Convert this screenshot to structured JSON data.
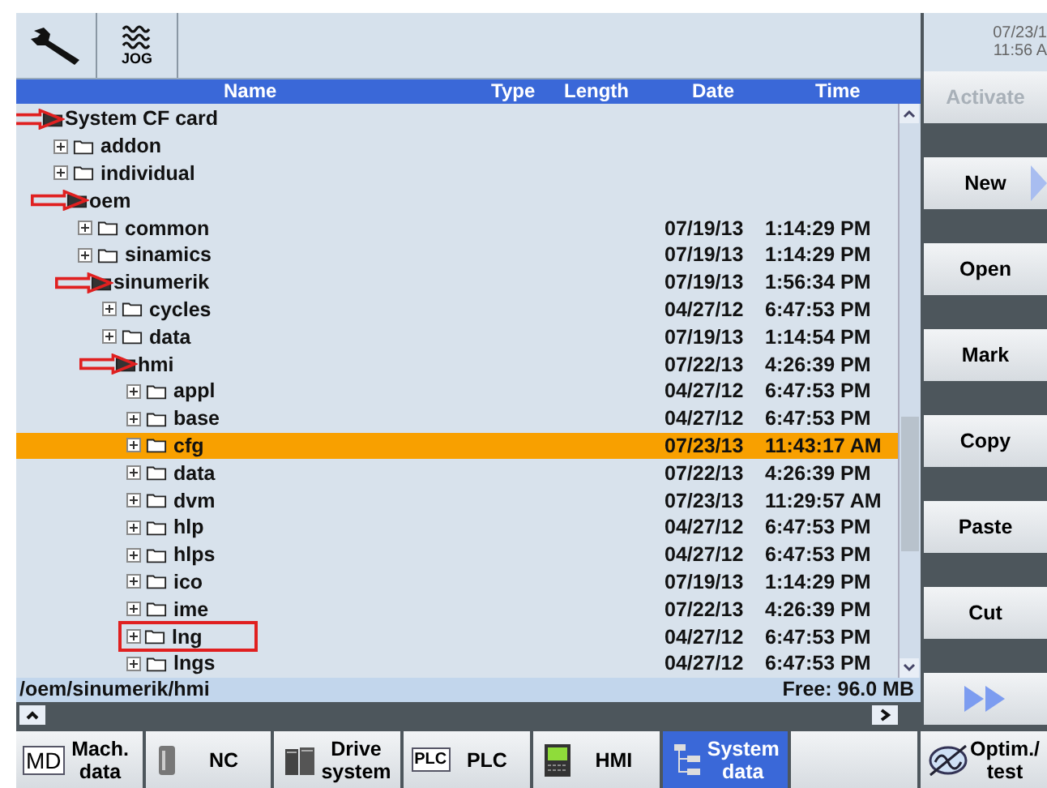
{
  "header": {
    "mode": "JOG",
    "date": "07/23/1",
    "time": "11:56 A"
  },
  "columns": [
    "Name",
    "Type",
    "Length",
    "Date",
    "Time"
  ],
  "tree": [
    {
      "name": "System CF card",
      "expanded": true,
      "selected": false,
      "kind": "arrow",
      "children": [
        {
          "name": "addon",
          "expanded": false,
          "selected": false,
          "kind": "plain"
        },
        {
          "name": "individual",
          "expanded": false,
          "selected": false,
          "kind": "plain"
        },
        {
          "name": "oem",
          "expanded": true,
          "selected": false,
          "kind": "arrow",
          "children": [
            {
              "name": "common",
              "expanded": false,
              "selected": false,
              "kind": "plain",
              "date": "07/19/13",
              "time": "1:14:29 PM"
            },
            {
              "name": "sinamics",
              "expanded": false,
              "selected": false,
              "kind": "plain",
              "date": "07/19/13",
              "time": "1:14:29 PM"
            },
            {
              "name": "sinumerik",
              "expanded": true,
              "selected": false,
              "kind": "arrow",
              "date": "07/19/13",
              "time": "1:56:34 PM",
              "children": [
                {
                  "name": "cycles",
                  "expanded": false,
                  "selected": false,
                  "kind": "plain",
                  "date": "04/27/12",
                  "time": "6:47:53 PM"
                },
                {
                  "name": "data",
                  "expanded": false,
                  "selected": false,
                  "kind": "plain",
                  "date": "07/19/13",
                  "time": "1:14:54 PM"
                },
                {
                  "name": "hmi",
                  "expanded": true,
                  "selected": false,
                  "kind": "arrow",
                  "date": "07/22/13",
                  "time": "4:26:39 PM",
                  "children": [
                    {
                      "name": "appl",
                      "expanded": false,
                      "selected": false,
                      "kind": "plain",
                      "date": "04/27/12",
                      "time": "6:47:53 PM"
                    },
                    {
                      "name": "base",
                      "expanded": false,
                      "selected": false,
                      "kind": "plain",
                      "date": "04/27/12",
                      "time": "6:47:53 PM"
                    },
                    {
                      "name": "cfg",
                      "expanded": false,
                      "selected": true,
                      "kind": "plain",
                      "date": "07/23/13",
                      "time": "11:43:17 AM"
                    },
                    {
                      "name": "data",
                      "expanded": false,
                      "selected": false,
                      "kind": "plain",
                      "date": "07/22/13",
                      "time": "4:26:39 PM"
                    },
                    {
                      "name": "dvm",
                      "expanded": false,
                      "selected": false,
                      "kind": "plain",
                      "date": "07/23/13",
                      "time": "11:29:57 AM"
                    },
                    {
                      "name": "hlp",
                      "expanded": false,
                      "selected": false,
                      "kind": "plain",
                      "date": "04/27/12",
                      "time": "6:47:53 PM"
                    },
                    {
                      "name": "hlps",
                      "expanded": false,
                      "selected": false,
                      "kind": "plain",
                      "date": "04/27/12",
                      "time": "6:47:53 PM"
                    },
                    {
                      "name": "ico",
                      "expanded": false,
                      "selected": false,
                      "kind": "plain",
                      "date": "07/19/13",
                      "time": "1:14:29 PM"
                    },
                    {
                      "name": "ime",
                      "expanded": false,
                      "selected": false,
                      "kind": "plain",
                      "date": "07/22/13",
                      "time": "4:26:39 PM"
                    },
                    {
                      "name": "lng",
                      "expanded": false,
                      "selected": false,
                      "kind": "box",
                      "date": "04/27/12",
                      "time": "6:47:53 PM"
                    },
                    {
                      "name": "lngs",
                      "expanded": false,
                      "selected": false,
                      "kind": "plain",
                      "date": "04/27/12",
                      "time": "6:47:53 PM"
                    }
                  ]
                }
              ]
            }
          ]
        }
      ]
    }
  ],
  "path": "/oem/sinumerik/hmi",
  "free": "Free: 96.0 MB",
  "softkeys": [
    {
      "label": "Activate",
      "disabled": true,
      "kind": "text"
    },
    {
      "label": "New",
      "disabled": false,
      "kind": "more"
    },
    {
      "label": "Open",
      "disabled": false,
      "kind": "text"
    },
    {
      "label": "Mark",
      "disabled": false,
      "kind": "text"
    },
    {
      "label": "Copy",
      "disabled": false,
      "kind": "text"
    },
    {
      "label": "Paste",
      "disabled": false,
      "kind": "text"
    },
    {
      "label": "Cut",
      "disabled": false,
      "kind": "text"
    },
    {
      "kind": "forward"
    }
  ],
  "bottom_keys": [
    {
      "label": "Mach. data",
      "kind": "md",
      "icon_text": "MD",
      "selected": false
    },
    {
      "label": "NC",
      "kind": "nc",
      "selected": false
    },
    {
      "label": "Drive system",
      "kind": "drive",
      "selected": false
    },
    {
      "label": "PLC",
      "kind": "plc",
      "icon_text": "PLC",
      "selected": false
    },
    {
      "label": "HMI",
      "kind": "hmi",
      "selected": false
    },
    {
      "label": "System data",
      "kind": "tree",
      "selected": true
    },
    {
      "kind": "empty",
      "selected": false
    },
    {
      "label": "Optim./ test",
      "kind": "scope",
      "selected": false
    }
  ]
}
